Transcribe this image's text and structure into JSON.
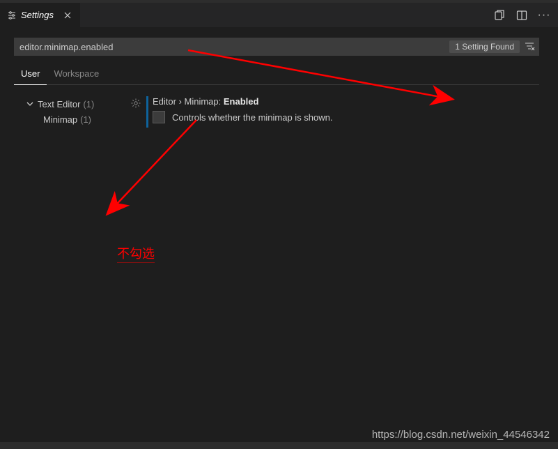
{
  "tab": {
    "label": "Settings"
  },
  "search": {
    "value": "editor.minimap.enabled",
    "result_count": "1 Setting Found"
  },
  "scopes": {
    "user": "User",
    "workspace": "Workspace"
  },
  "tree": {
    "text_editor": {
      "label": "Text Editor",
      "count": "(1)"
    },
    "minimap": {
      "label": "Minimap",
      "count": "(1)"
    }
  },
  "setting": {
    "breadcrumb_prefix": "Editor › Minimap: ",
    "name": "Enabled",
    "description": "Controls whether the minimap is shown."
  },
  "annotation": {
    "text": "不勾选"
  },
  "watermark": "https://blog.csdn.net/weixin_44546342"
}
